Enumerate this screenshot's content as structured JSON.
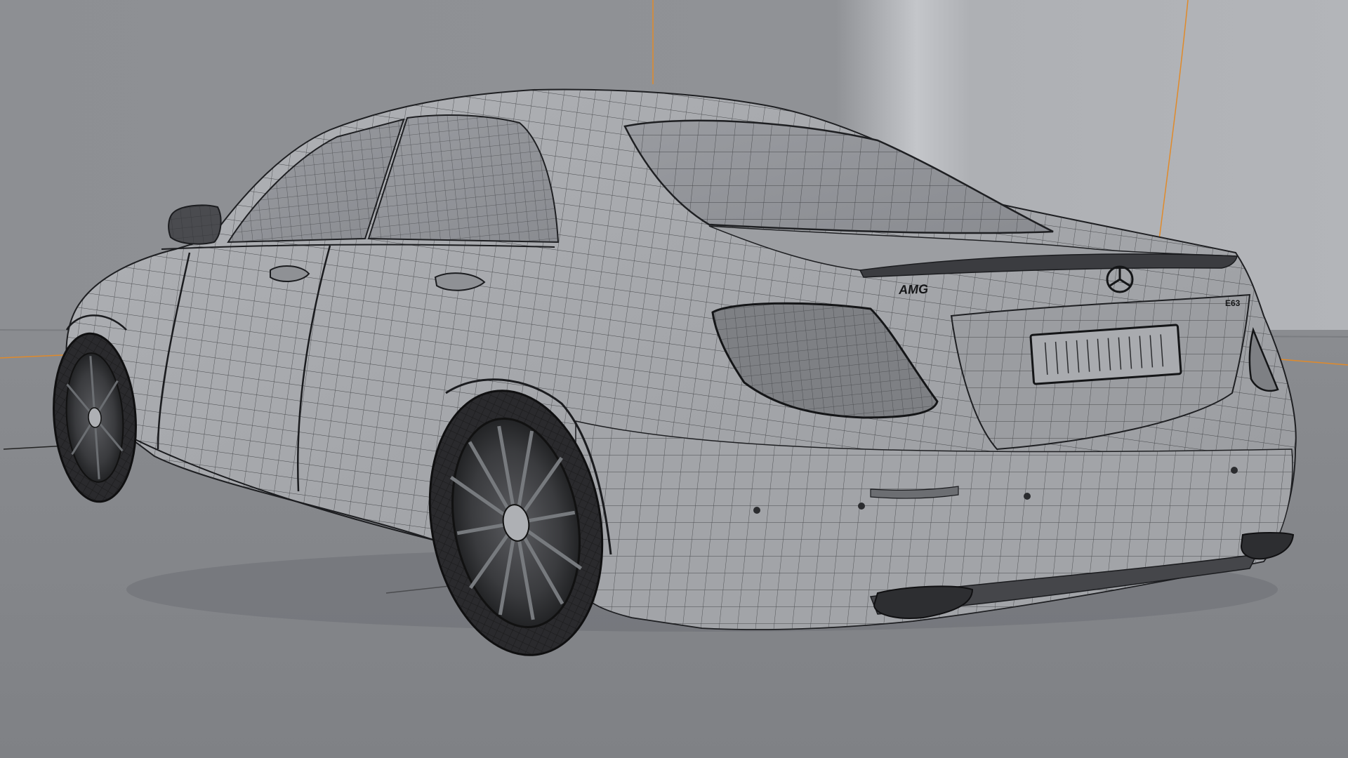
{
  "scene": {
    "subject": "car-wireframe",
    "colors": {
      "background_top": "#8d8f93",
      "background_wall_right": "#b4b6ba",
      "floor": "#85878b",
      "body": "#a7a9ad",
      "wire": "#2b2c2f",
      "accent_orange": "#e08a2a",
      "tire": "#2a2a2d"
    }
  },
  "badges": {
    "model_badge": "AMG",
    "trunk_badge": "E63"
  }
}
